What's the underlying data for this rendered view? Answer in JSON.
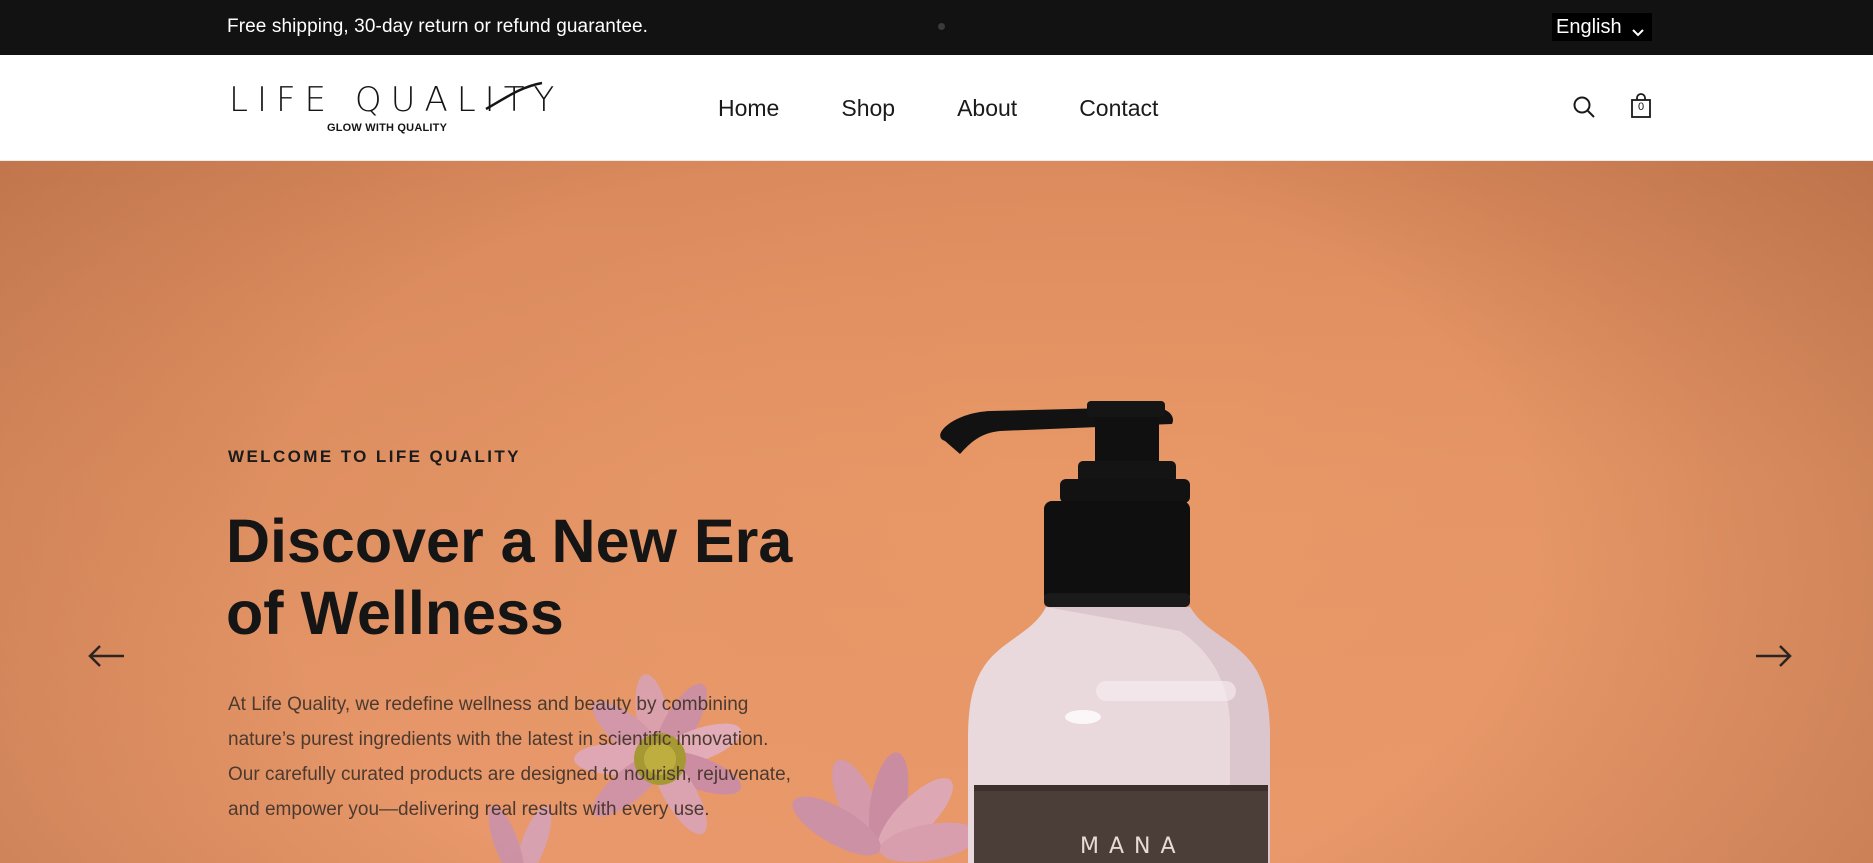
{
  "announcement": {
    "text": "Free shipping, 30-day return or refund guarantee.",
    "language": "English"
  },
  "brand": {
    "name": "LIFE QUALITY",
    "tagline": "GLOW WITH QUALITY"
  },
  "nav": {
    "items": [
      {
        "label": "Home"
      },
      {
        "label": "Shop"
      },
      {
        "label": "About"
      },
      {
        "label": "Contact"
      }
    ]
  },
  "header_icons": {
    "search": "search-icon",
    "cart": "shopping-bag-icon",
    "cart_count": "0"
  },
  "hero": {
    "eyebrow": "WELCOME TO LIFE QUALITY",
    "headline": "Discover a New Era of Wellness",
    "body": "At Life Quality, we redefine wellness and beauty by combining nature’s purest ingredients with the latest in scientific innovation. Our carefully curated products are designed to nourish, rejuvenate, and empower you—delivering real results with every use.",
    "product_label": "MANA",
    "prev_icon": "arrow-left-icon",
    "next_icon": "arrow-right-icon"
  },
  "colors": {
    "topbar": "#121212",
    "hero_bg": "#e49566",
    "text_dark": "#151515"
  }
}
